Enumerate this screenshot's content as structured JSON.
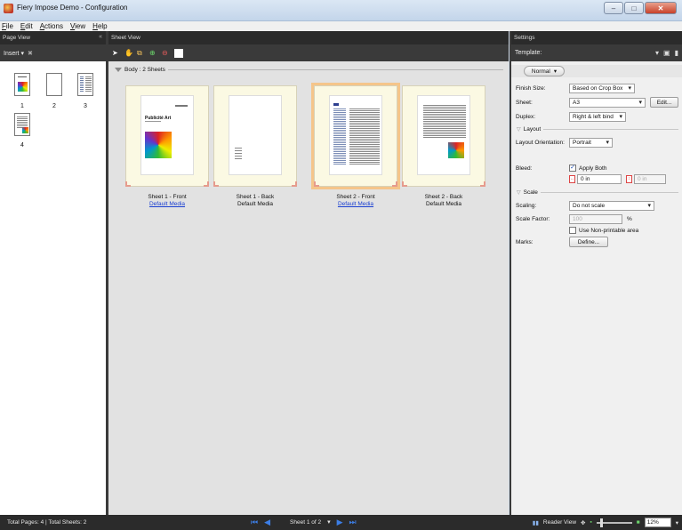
{
  "window": {
    "title": "Fiery Impose Demo - Configuration"
  },
  "menu": [
    "File",
    "Edit",
    "Actions",
    "View",
    "Help"
  ],
  "page_view": {
    "header": "Page View",
    "insert_label": "Insert",
    "thumbnails": [
      {
        "label": "1"
      },
      {
        "label": "2"
      },
      {
        "label": "3"
      },
      {
        "label": "4"
      }
    ]
  },
  "sheet_view": {
    "header": "Sheet View",
    "section_label": "Body : 2 Sheets",
    "sheets": [
      {
        "name": "Sheet 1 - Front",
        "media": "Default Media",
        "media_link": true,
        "selected": false
      },
      {
        "name": "Sheet 1 - Back",
        "media": "Default Media",
        "media_link": false,
        "selected": false
      },
      {
        "name": "Sheet 2 - Front",
        "media": "Default Media",
        "media_link": true,
        "selected": true
      },
      {
        "name": "Sheet 2 - Back",
        "media": "Default Media",
        "media_link": false,
        "selected": false
      }
    ],
    "page_heading": "Publicité Art"
  },
  "settings": {
    "header": "Settings",
    "template_label": "Template:",
    "mode": "Normal",
    "finish_size": {
      "label": "Finish Size:",
      "value": "Based on Crop Box"
    },
    "sheet": {
      "label": "Sheet:",
      "value": "A3",
      "edit": "Edit..."
    },
    "duplex": {
      "label": "Duplex:",
      "value": "Right & left bind"
    },
    "layout_section": "Layout",
    "layout_orientation": {
      "label": "Layout Orientation:",
      "value": "Portrait"
    },
    "bleed": {
      "label": "Bleed:",
      "apply_both": "Apply Both",
      "value1": "0 in",
      "value2": "0 in"
    },
    "scale_section": "Scale",
    "scaling": {
      "label": "Scaling:",
      "value": "Do not scale"
    },
    "scale_factor": {
      "label": "Scale Factor:",
      "value": "100",
      "unit": "%"
    },
    "non_printable": "Use Non-printable area",
    "marks": {
      "label": "Marks:",
      "button": "Define..."
    }
  },
  "status": {
    "totals": "Total Pages: 4 | Total Sheets: 2",
    "sheet_indicator": "Sheet 1 of 2",
    "reader_view": "Reader View",
    "zoom": "12%"
  },
  "colors": {
    "accent_blue": "#3c7ee6",
    "selection_orange": "#f5c58a",
    "dark_panel": "#2b2b2b"
  }
}
